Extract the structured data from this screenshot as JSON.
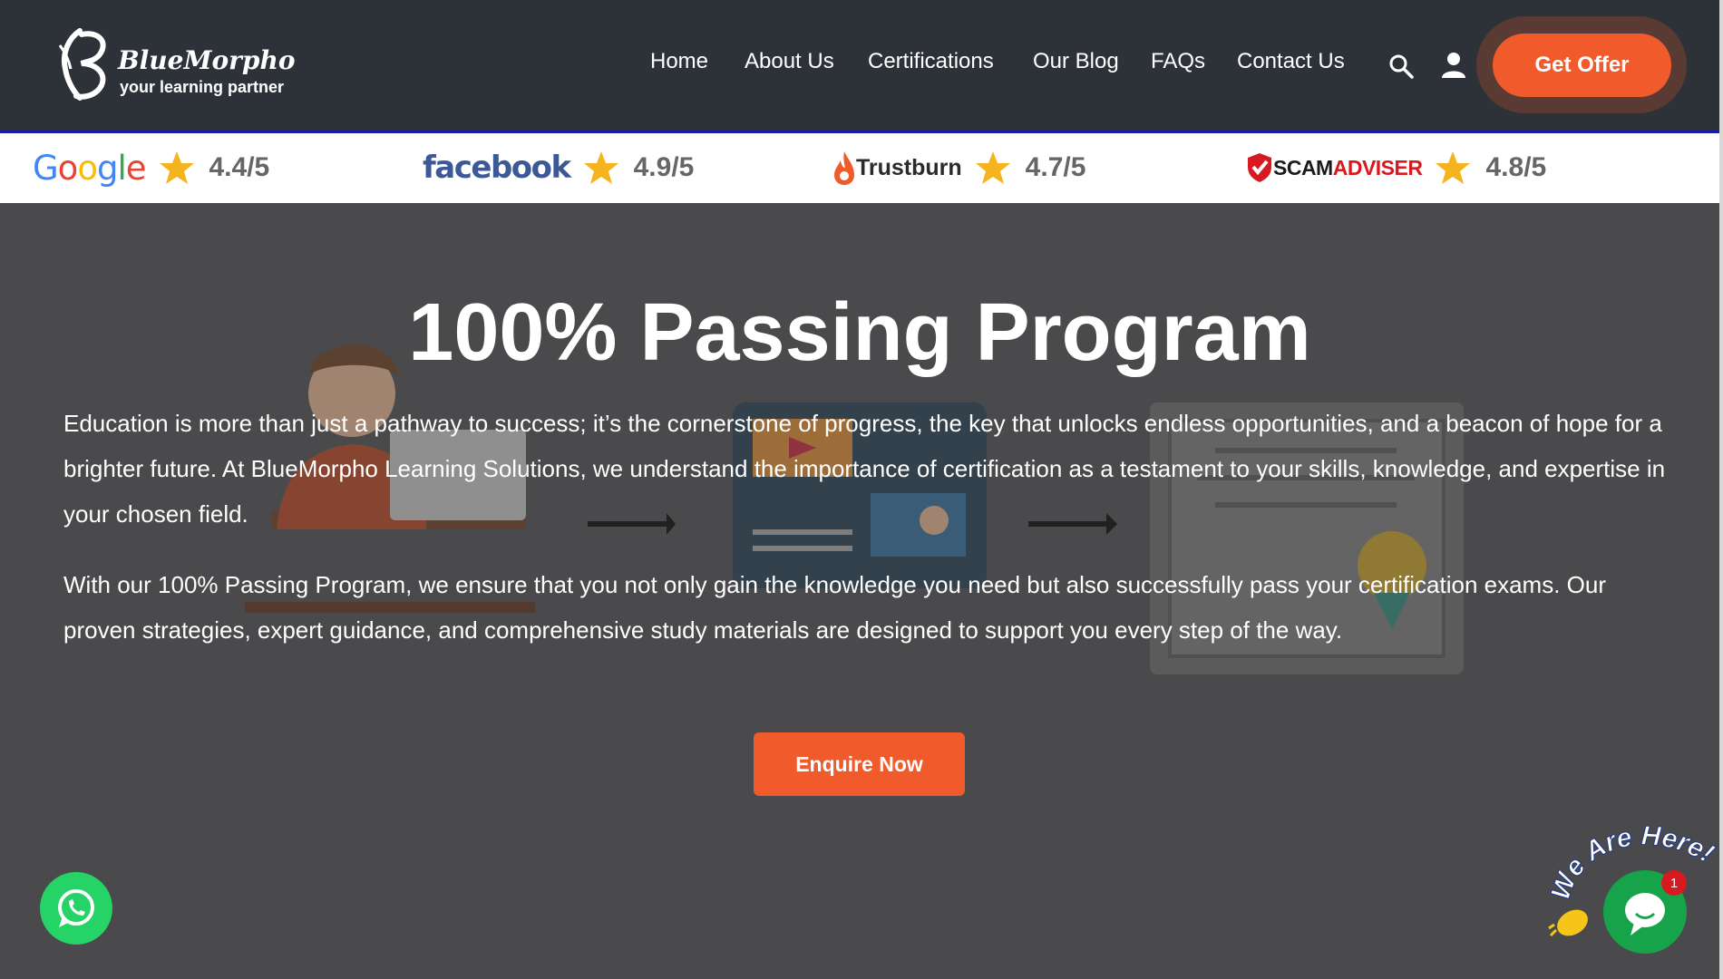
{
  "brand": {
    "name": "BlueMorpho",
    "tagline": "your learning partner"
  },
  "nav": {
    "items": [
      {
        "label": "Home"
      },
      {
        "label": "About Us"
      },
      {
        "label": "Certifications"
      },
      {
        "label": "Our Blog"
      },
      {
        "label": "FAQs"
      },
      {
        "label": "Contact Us"
      }
    ],
    "offer_label": "Get Offer"
  },
  "ratings": [
    {
      "brand": "Google",
      "score": "4.4/5"
    },
    {
      "brand": "facebook",
      "score": "4.9/5"
    },
    {
      "brand": "Trustburn",
      "score": "4.7/5"
    },
    {
      "brand": "SCAMADVISER",
      "brand_part1": "SCAM",
      "brand_part2": "ADVISER",
      "score": "4.8/5"
    }
  ],
  "hero": {
    "title": "100% Passing Program",
    "paragraph1": "Education is more than just a pathway to success; it’s the cornerstone of progress, the key that unlocks endless opportunities, and a beacon of hope for a brighter future. At BlueMorpho Learning Solutions, we understand the importance of certification as a testament to your skills, knowledge, and expertise in your chosen field.",
    "paragraph2": "With our 100% Passing Program, we ensure that you not only gain the knowledge you need but also successfully pass your certification exams. Our proven strategies, expert guidance, and comprehensive study materials are designed to support you every step of the way.",
    "cta_label": "Enquire Now"
  },
  "chat": {
    "banner": "We Are Here!",
    "unread_count": "1"
  },
  "colors": {
    "accent": "#f15a2b",
    "header_bg": "#2d3239",
    "hero_bg": "#4a4a4c",
    "whatsapp": "#25d366",
    "chat": "#17a34a"
  },
  "icons": [
    "logo-icon",
    "search-icon",
    "user-icon",
    "star-icon",
    "whatsapp-icon",
    "chat-icon",
    "waving-hand-icon"
  ]
}
